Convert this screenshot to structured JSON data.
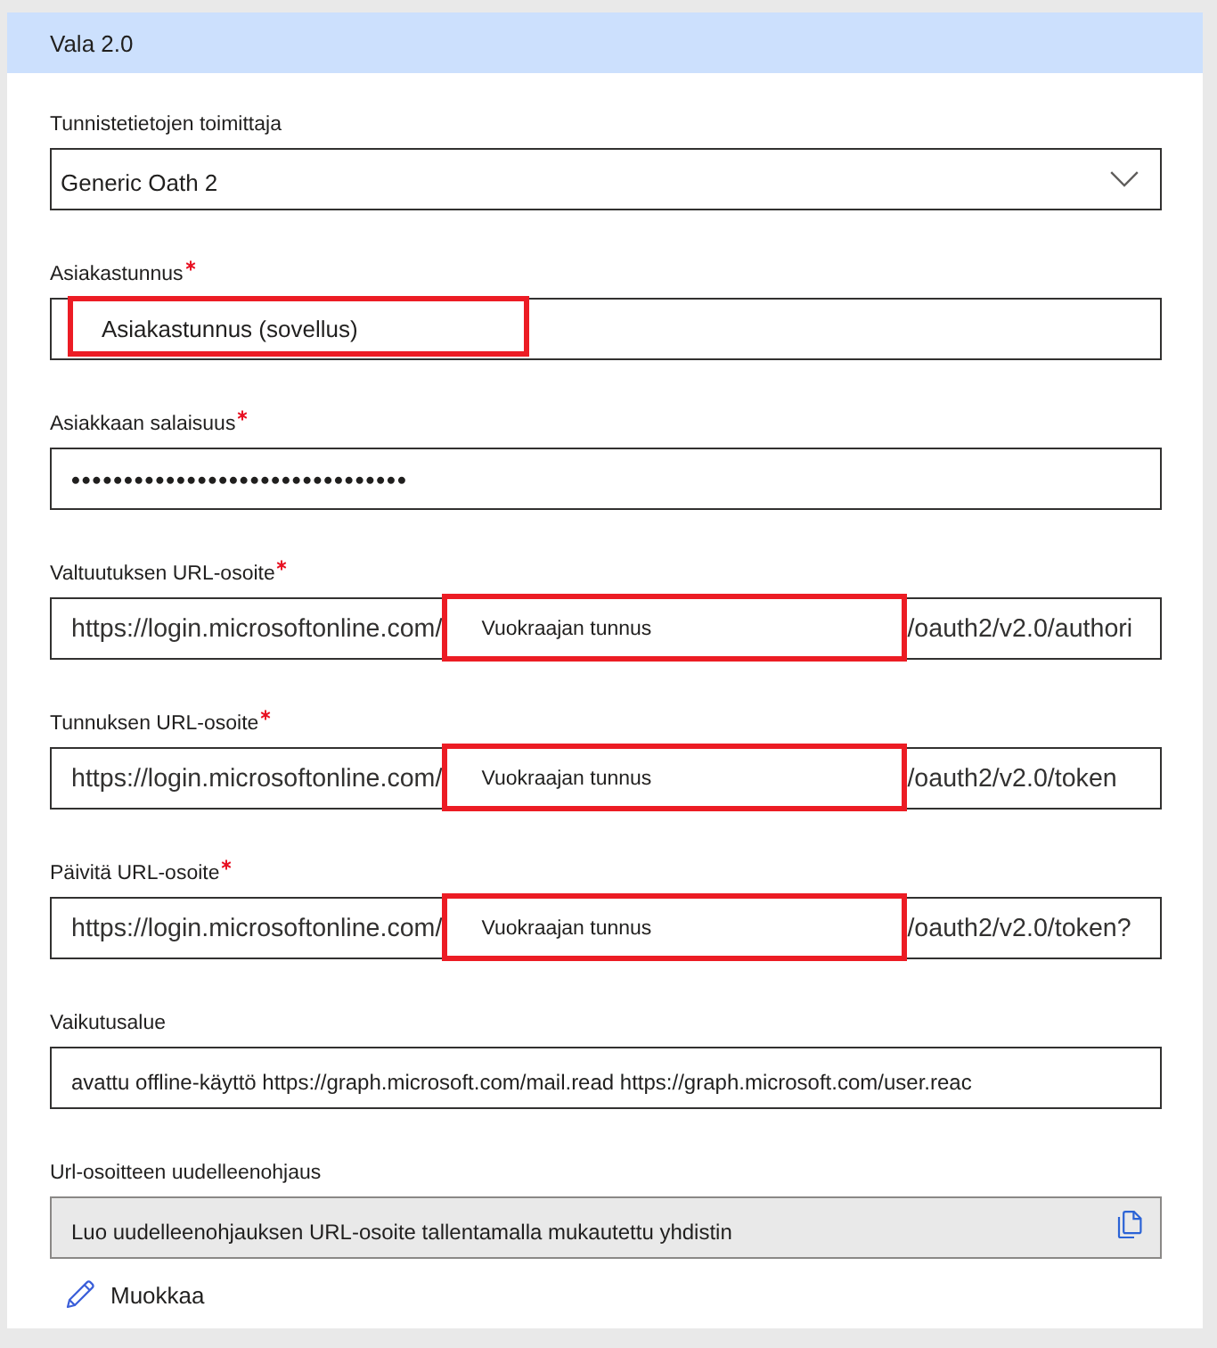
{
  "panel": {
    "title": "Vala 2.0"
  },
  "fields": [
    {
      "kind": "dropdown",
      "label": "Tunnistetietojen toimittaja",
      "required": false,
      "value": "Generic Oath 2"
    },
    {
      "kind": "segmented",
      "label": "Asiakastunnus",
      "required": true,
      "parts": [
        {
          "kind": "highlight",
          "text": "Asiakastunnus (sovellus)"
        }
      ]
    },
    {
      "kind": "password",
      "label": "Asiakkaan salaisuus",
      "required": true,
      "value": "••••••••••••••••••••••••••••••••"
    },
    {
      "kind": "segmented",
      "label": "Valtuutuksen URL-osoite",
      "required": true,
      "parts": [
        {
          "kind": "plain",
          "text": "https://login.microsoftonline.com/"
        },
        {
          "kind": "highlight",
          "text": "Vuokraajan tunnus"
        },
        {
          "kind": "plain",
          "text": "/oauth2/v2.0/authori"
        }
      ]
    },
    {
      "kind": "segmented",
      "label": "Tunnuksen URL-osoite",
      "required": true,
      "parts": [
        {
          "kind": "plain",
          "text": "https://login.microsoftonline.com/"
        },
        {
          "kind": "highlight",
          "text": "Vuokraajan tunnus"
        },
        {
          "kind": "plain",
          "text": "/oauth2/v2.0/token"
        }
      ]
    },
    {
      "kind": "segmented",
      "label": "Päivitä URL-osoite",
      "required": true,
      "parts": [
        {
          "kind": "plain",
          "text": "https://login.microsoftonline.com/"
        },
        {
          "kind": "highlight",
          "text": "Vuokraajan tunnus"
        },
        {
          "kind": "plain",
          "text": "/oauth2/v2.0/token?"
        }
      ]
    },
    {
      "kind": "text",
      "label": "Vaikutusalue",
      "required": false,
      "value": "avattu offline-käyttö https://graph.microsoft.com/mail.read https://graph.microsoft.com/user.reac"
    },
    {
      "kind": "readonly",
      "label": "Url-osoitteen uudelleenohjaus",
      "required": false,
      "value": "Luo uudelleenohjauksen URL-osoite tallentamalla mukautettu yhdistin"
    }
  ],
  "edit_link": {
    "label": "Muokkaa"
  }
}
